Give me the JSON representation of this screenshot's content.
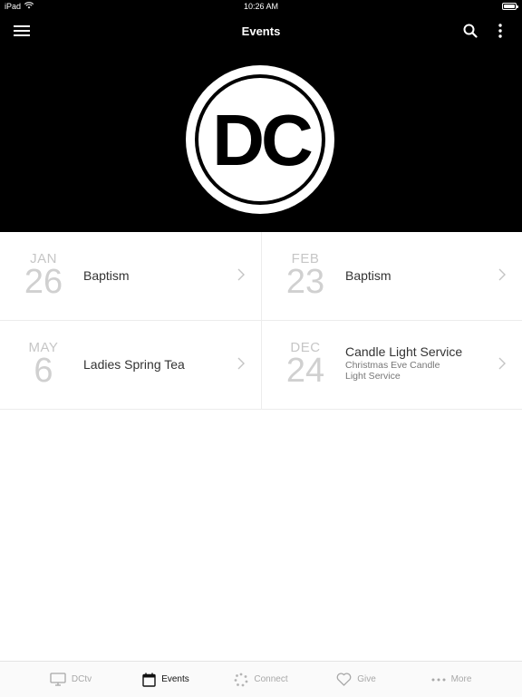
{
  "status_bar": {
    "carrier": "iPad",
    "time": "10:26 AM"
  },
  "header": {
    "title": "Events"
  },
  "hero": {
    "logo_text": "DC"
  },
  "events": [
    {
      "month": "JAN",
      "day": "26",
      "title": "Baptism",
      "subtitle": ""
    },
    {
      "month": "FEB",
      "day": "23",
      "title": "Baptism",
      "subtitle": ""
    },
    {
      "month": "MAY",
      "day": "6",
      "title": "Ladies Spring Tea",
      "subtitle": ""
    },
    {
      "month": "DEC",
      "day": "24",
      "title": "Candle Light Service",
      "subtitle": "Christmas Eve Candle Light Service"
    }
  ],
  "tabs": [
    {
      "label": "DCtv",
      "icon": "tv-icon",
      "active": false
    },
    {
      "label": "Events",
      "icon": "calendar-icon",
      "active": true
    },
    {
      "label": "Connect",
      "icon": "connect-icon",
      "active": false
    },
    {
      "label": "Give",
      "icon": "heart-icon",
      "active": false
    },
    {
      "label": "More",
      "icon": "more-dots-icon",
      "active": false
    }
  ],
  "colors": {
    "bar_bg": "#000000",
    "tab_active": "#111111",
    "tab_inactive": "#a8a8a8",
    "date_text": "#c6c6c6"
  }
}
